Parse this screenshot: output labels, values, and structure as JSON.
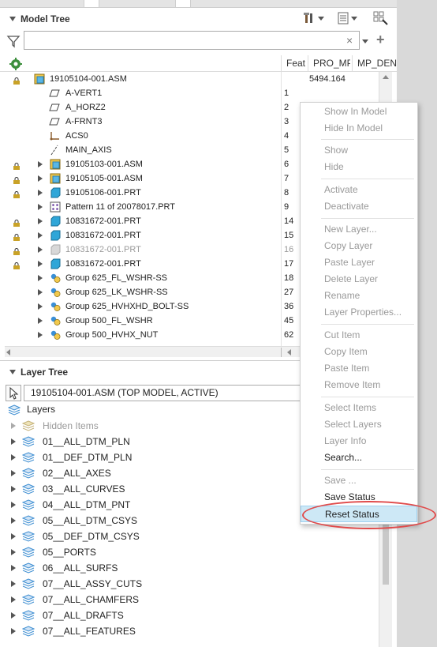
{
  "model_tree": {
    "title": "Model Tree",
    "filter_placeholder": "",
    "clear_glyph": "×",
    "add_glyph": "+",
    "columns": {
      "feat": "Feat",
      "pro_mp": "PRO_MP",
      "mp_den": "MP_DEN"
    },
    "rows": [
      {
        "label": "19105104-001.ASM",
        "feat": "",
        "pro": "5494.164"
      },
      {
        "label": "A-VERT1",
        "feat": "1",
        "pro": ""
      },
      {
        "label": "A_HORZ2",
        "feat": "2",
        "pro": ""
      },
      {
        "label": "A-FRNT3",
        "feat": "3",
        "pro": ""
      },
      {
        "label": "ACS0",
        "feat": "4",
        "pro": ""
      },
      {
        "label": "MAIN_AXIS",
        "feat": "5",
        "pro": ""
      },
      {
        "label": "19105103-001.ASM",
        "feat": "6",
        "pro": ""
      },
      {
        "label": "19105105-001.ASM",
        "feat": "7",
        "pro": ""
      },
      {
        "label": "19105106-001.PRT",
        "feat": "8",
        "pro": ""
      },
      {
        "label": "Pattern 11 of 20078017.PRT",
        "feat": "9",
        "pro": ""
      },
      {
        "label": "10831672-001.PRT",
        "feat": "14",
        "pro": ""
      },
      {
        "label": "10831672-001.PRT",
        "feat": "15",
        "pro": ""
      },
      {
        "label": "10831672-001.PRT",
        "feat": "16",
        "pro": ""
      },
      {
        "label": "10831672-001.PRT",
        "feat": "17",
        "pro": ""
      },
      {
        "label": "Group 625_FL_WSHR-SS",
        "feat": "18",
        "pro": ""
      },
      {
        "label": "Group 625_LK_WSHR-SS",
        "feat": "27",
        "pro": ""
      },
      {
        "label": "Group 625_HVHXHD_BOLT-SS",
        "feat": "36",
        "pro": ""
      },
      {
        "label": "Group 500_FL_WSHR",
        "feat": "45",
        "pro": ""
      },
      {
        "label": "Group 500_HVHX_NUT",
        "feat": "62",
        "pro": ""
      }
    ]
  },
  "layer_tree": {
    "title": "Layer Tree",
    "active_model": "19105104-001.ASM (TOP MODEL, ACTIVE)",
    "layers_label": "Layers",
    "layers": [
      "Hidden Items",
      "01__ALL_DTM_PLN",
      "01__DEF_DTM_PLN",
      "02__ALL_AXES",
      "03__ALL_CURVES",
      "04__ALL_DTM_PNT",
      "05__ALL_DTM_CSYS",
      "05__DEF_DTM_CSYS",
      "05__PORTS",
      "06__ALL_SURFS",
      "07__ALL_ASSY_CUTS",
      "07__ALL_CHAMFERS",
      "07__ALL_DRAFTS",
      "07__ALL_FEATURES"
    ]
  },
  "context_menu": {
    "items": [
      "Show In Model",
      "Hide In Model",
      "Show",
      "Hide",
      "Activate",
      "Deactivate",
      "New Layer...",
      "Copy Layer",
      "Paste Layer",
      "Delete Layer",
      "Rename",
      "Layer Properties...",
      "Cut Item",
      "Copy Item",
      "Paste Item",
      "Remove Item",
      "Select Items",
      "Select Layers",
      "Layer Info",
      "Search...",
      "Save ...",
      "Save Status",
      "Reset Status"
    ],
    "highlighted": "Reset Status"
  },
  "colors": {
    "highlight": "#cde8f6",
    "annotation_ring": "#e04b4b",
    "layer_icon": "#3f8fd2",
    "part_icon": "#2fa6d8",
    "assembly_icon": "#f2c94c"
  }
}
